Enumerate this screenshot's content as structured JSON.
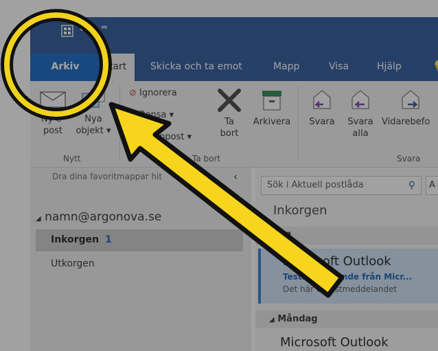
{
  "ribbon_tabs": [
    "Arkiv",
    "Start",
    "Skicka och ta emot",
    "Mapp",
    "Visa",
    "Hjälp"
  ],
  "groups": {
    "nytt": {
      "label": "Nytt",
      "new_email_l1": "Ny e-",
      "new_email_l2": "post",
      "new_items_l1": "Nya",
      "new_items_l2": "objekt ▾"
    },
    "ta_bort": {
      "label": "Ta bort",
      "ignore": "Ignorera",
      "clean": "Rensa ▾",
      "junk": "Skräppost ▾",
      "delete_l1": "Ta",
      "delete_l2": "bort",
      "archive": "Arkivera"
    },
    "svara": {
      "label": "Svara",
      "reply": "Svara",
      "reply_all_l1": "Svara",
      "reply_all_l2": "alla",
      "forward": "Vidarebefo"
    }
  },
  "nav": {
    "favorites_hint": "Dra dina favoritmappar hit",
    "collapse_glyph": "‹",
    "account": "namn@argonova.se",
    "inbox_label": "Inkorgen",
    "inbox_count": "1",
    "outbox_label": "Utkorgen"
  },
  "list": {
    "search_placeholder": "Sök i Aktuell postlåda",
    "filter_fragment": "A",
    "folder_title": "Inkorgen",
    "group1": "Idag",
    "msg1_sender": "Microsoft Outlook",
    "msg1_subject": "Testmeddelande från Micr...",
    "msg1_preview": "Det här e-postmeddelandet",
    "group2": "Måndag",
    "msg2_sender": "Microsoft Outlook"
  },
  "colors": {
    "titlebar_blue": "#2b579a",
    "arkiv_tab": "#1366c7",
    "highlight_ring": "#f2d31b",
    "arrow": "#f7d51d",
    "outline": "#111111"
  }
}
